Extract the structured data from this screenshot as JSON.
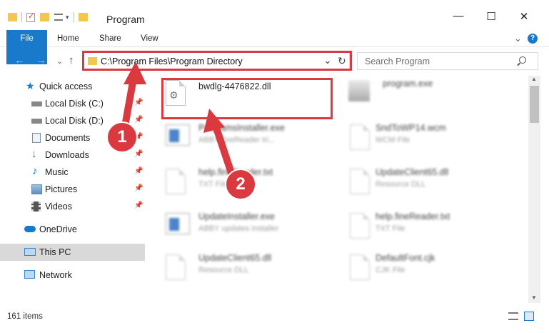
{
  "window": {
    "title": "Program",
    "minimize": "—",
    "maximize": "☐",
    "close": "✕"
  },
  "ribbon": {
    "tabs": [
      "File",
      "Home",
      "Share",
      "View"
    ],
    "collapse": "⌄",
    "help": "?"
  },
  "nav": {
    "back": "←",
    "forward": "→",
    "recent": "⌄",
    "up": "↑"
  },
  "address": {
    "path": "C:\\Program Files\\Program Directory",
    "dropdown": "⌄",
    "refresh": "↻"
  },
  "search": {
    "placeholder": "Search Program"
  },
  "sidebar": {
    "items": [
      {
        "label": "Quick access",
        "pinned": false
      },
      {
        "label": "Local Disk (C:)",
        "pinned": true
      },
      {
        "label": "Local Disk (D:)",
        "pinned": true
      },
      {
        "label": "Documents",
        "pinned": true
      },
      {
        "label": "Downloads",
        "pinned": true
      },
      {
        "label": "Music",
        "pinned": true
      },
      {
        "label": "Pictures",
        "pinned": true
      },
      {
        "label": "Videos",
        "pinned": true
      },
      {
        "label": "OneDrive",
        "pinned": false
      },
      {
        "label": "This PC",
        "pinned": false,
        "selected": true
      },
      {
        "label": "Network",
        "pinned": false
      }
    ]
  },
  "files": {
    "highlighted": {
      "name": "bwdlg-4476822.dll"
    },
    "items": [
      {
        "name": "program.exe",
        "type": ""
      },
      {
        "name": "ProgramsInstaller.exe",
        "type": "ABBY fineReader tri..."
      },
      {
        "name": "SndToWP14.wcm",
        "type": "WCM File"
      },
      {
        "name": "help.fineReader.txt",
        "type": "TXT File"
      },
      {
        "name": "UpdateClient65.dll",
        "type": "Resource DLL"
      },
      {
        "name": "UpdateInstaller.exe",
        "type": "ABBY updates installer"
      },
      {
        "name": "help.fineReader.txt",
        "type": "TXT File"
      },
      {
        "name": "UpdateClient65.dll",
        "type": "Resource DLL"
      },
      {
        "name": "DefaultFont.cjk",
        "type": "CJK File"
      }
    ]
  },
  "status": {
    "count": "161 items"
  },
  "annotations": {
    "step1": "1",
    "step2": "2",
    "color": "#d9393f"
  }
}
